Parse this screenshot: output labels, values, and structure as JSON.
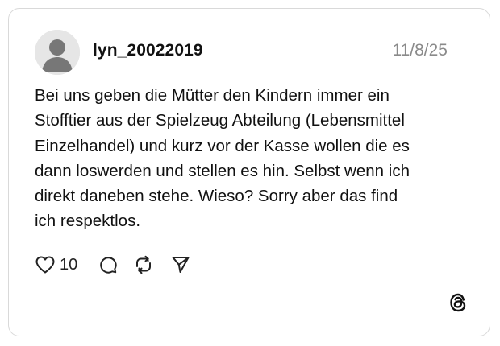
{
  "post": {
    "username": "lyn_20022019",
    "date": "11/8/25",
    "text_lines": [
      "Bei uns geben die Mütter den Kindern immer ein",
      "Stofftier aus der Spielzeug Abteilung (Lebensmittel",
      "Einzelhandel) und kurz vor der Kasse wollen die es",
      "dann loswerden und stellen es hin. Selbst wenn ich",
      "direkt daneben stehe. Wieso? Sorry aber das find",
      "ich respektlos."
    ],
    "like_count": "10"
  },
  "icons": {
    "avatar": "default-avatar-icon",
    "like": "heart-icon",
    "reply": "comment-icon",
    "repost": "repost-icon",
    "share": "send-icon",
    "brand": "threads-logo-icon"
  }
}
